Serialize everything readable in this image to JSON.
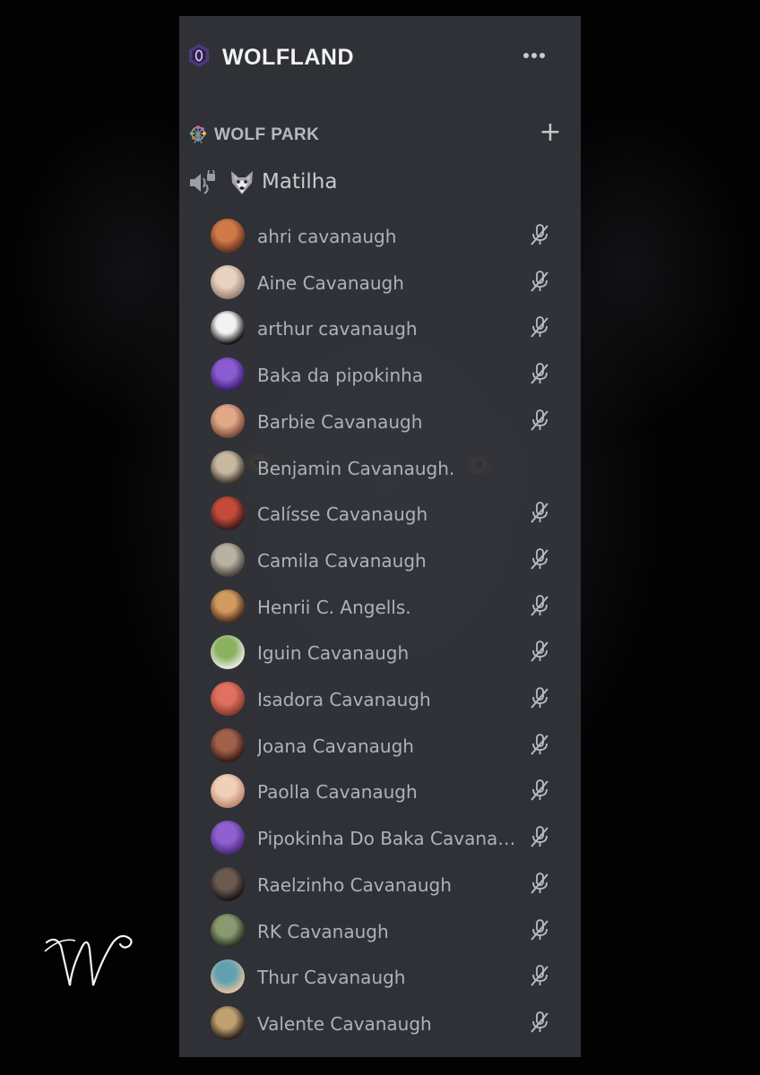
{
  "server": {
    "name": "WOLFLAND",
    "icon": "server-gem-icon",
    "menu_icon": "more-dots-icon"
  },
  "category": {
    "name": "WOLF PARK",
    "icon": "ferris-wheel-emoji",
    "add_icon": "plus-icon",
    "add_label": "+"
  },
  "channel": {
    "name": "Matilha",
    "type_icon": "voice-channel-locked-icon",
    "emoji": "wolf-emoji"
  },
  "members": [
    {
      "name": "ahri cavanaugh",
      "muted": true,
      "avatar_colors": [
        "#d07a4a",
        "#6a3320"
      ]
    },
    {
      "name": "Aine Cavanaugh",
      "muted": true,
      "avatar_colors": [
        "#e8d2c0",
        "#9a8070"
      ]
    },
    {
      "name": "arthur cavanaugh",
      "muted": true,
      "avatar_colors": [
        "#f2f2f2",
        "#111111"
      ]
    },
    {
      "name": "Baka da pipokinha",
      "muted": true,
      "avatar_colors": [
        "#8b5bd4",
        "#3a1f6a"
      ]
    },
    {
      "name": "Barbie Cavanaugh",
      "muted": true,
      "avatar_colors": [
        "#e0a888",
        "#7a4a3a"
      ]
    },
    {
      "name": "Benjamin Cavanaugh.",
      "muted": false,
      "avatar_colors": [
        "#c9b8a0",
        "#3a3128"
      ]
    },
    {
      "name": "Calísse Cavanaugh",
      "muted": true,
      "avatar_colors": [
        "#c44a3a",
        "#3a1a1a"
      ]
    },
    {
      "name": "Camila Cavanaugh",
      "muted": true,
      "avatar_colors": [
        "#b8b0a0",
        "#4a463e"
      ]
    },
    {
      "name": "Henrii C. Angells.",
      "muted": true,
      "avatar_colors": [
        "#d09a60",
        "#4a2a1a"
      ]
    },
    {
      "name": "Iguin Cavanaugh",
      "muted": true,
      "avatar_colors": [
        "#8ab060",
        "#e8e8e0"
      ]
    },
    {
      "name": "Isadora Cavanaugh",
      "muted": true,
      "avatar_colors": [
        "#e07060",
        "#8a3a30"
      ]
    },
    {
      "name": "Joana Cavanaugh",
      "muted": true,
      "avatar_colors": [
        "#a0604a",
        "#3a1a14"
      ]
    },
    {
      "name": "Paolla Cavanaugh",
      "muted": true,
      "avatar_colors": [
        "#f0d0b8",
        "#c08870"
      ]
    },
    {
      "name": "Pipokinha Do Baka Cavanau...",
      "muted": true,
      "avatar_colors": [
        "#9060d0",
        "#4a2a80"
      ]
    },
    {
      "name": "Raelzinho Cavanaugh",
      "muted": true,
      "avatar_colors": [
        "#6a5a50",
        "#1a1614"
      ]
    },
    {
      "name": "RK Cavanaugh",
      "muted": true,
      "avatar_colors": [
        "#8a9a70",
        "#2a3020"
      ]
    },
    {
      "name": "Thur Cavanaugh",
      "muted": true,
      "avatar_colors": [
        "#60a0b0",
        "#e0c0a0"
      ]
    },
    {
      "name": "Valente Cavanaugh",
      "muted": true,
      "avatar_colors": [
        "#c0a070",
        "#2a2018"
      ]
    }
  ],
  "mute_icon": "microphone-muted-icon",
  "signature_icon": "w-signature-logo"
}
